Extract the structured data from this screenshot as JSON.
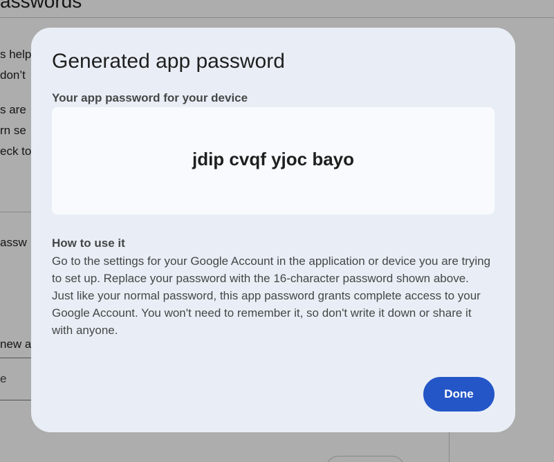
{
  "background": {
    "page_title_fragment": "asswords",
    "lines": [
      {
        "text": "s help"
      },
      {
        "text": "don’t"
      },
      {
        "text": "s are"
      },
      {
        "text": "rn se"
      },
      {
        "text": "eck to"
      },
      {
        "text": "assw"
      },
      {
        "text": "new ap"
      }
    ],
    "field_value": "e"
  },
  "dialog": {
    "title": "Generated app password",
    "password_label": "Your app password for your device",
    "password_value": "jdip cvqf yjoc bayo",
    "howto_heading": "How to use it",
    "howto_paragraph_1": "Go to the settings for your Google Account in the application or device you are trying to set up. Replace your password with the 16-character password shown above.",
    "howto_paragraph_2": "Just like your normal password, this app password grants complete access to your Google Account. You won't need to remember it, so don't write it down or share it with anyone.",
    "done_label": "Done"
  },
  "colors": {
    "dialog_background": "#e9eef6",
    "password_box_background": "#f8fafd",
    "primary_button": "#2456c7",
    "scrim": "rgba(0,0,0,0.32)"
  }
}
